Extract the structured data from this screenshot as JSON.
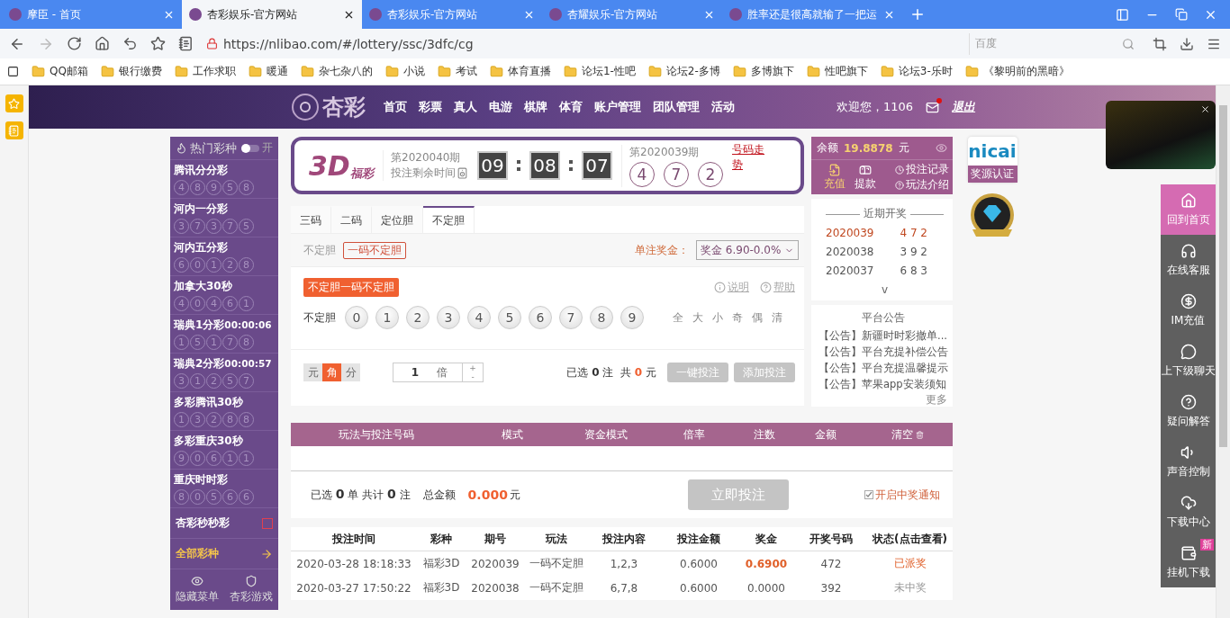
{
  "browser": {
    "tabs": [
      {
        "title": "摩臣 - 首页",
        "selected": false
      },
      {
        "title": "杏彩娱乐-官方网站",
        "selected": true
      },
      {
        "title": "杏彩娱乐-官方网站",
        "selected": false
      },
      {
        "title": "杏耀娱乐-官方网站",
        "selected": false
      },
      {
        "title": "胜率还是很高就输了一把运",
        "selected": false
      }
    ],
    "url": "https://nlibao.com/#/lottery/ssc/3dfc/cg",
    "search_placeholder": "百度",
    "bookmarks": [
      "QQ邮箱",
      "银行缴费",
      "工作求职",
      "暖通",
      "杂七杂八的",
      "小说",
      "考试",
      "体育直播",
      "论坛1-性吧",
      "论坛2-多博",
      "多博旗下",
      "性吧旗下",
      "论坛3-乐时",
      "《黎明前的黑暗》"
    ]
  },
  "header": {
    "logo": "杏彩",
    "nav": [
      "首页",
      "彩票",
      "真人",
      "电游",
      "棋牌",
      "体育",
      "账户管理",
      "团队管理",
      "活动"
    ],
    "welcome": "欢迎您，1106",
    "unread_mail": true,
    "logout": "退出"
  },
  "sidebar": {
    "title": "热门彩种",
    "toggle_label": "开",
    "toggle_on": false,
    "games": [
      {
        "name": "腾讯分分彩",
        "numbers": [
          "4",
          "8",
          "9",
          "5",
          "8"
        ]
      },
      {
        "name": "河内一分彩",
        "numbers": [
          "3",
          "7",
          "3",
          "7",
          "5"
        ]
      },
      {
        "name": "河内五分彩",
        "numbers": [
          "6",
          "0",
          "1",
          "2",
          "8"
        ]
      },
      {
        "name": "加拿大30秒",
        "numbers": [
          "4",
          "0",
          "4",
          "6",
          "1"
        ]
      },
      {
        "name": "瑞典1分彩",
        "timer": "00:00:06",
        "numbers": [
          "1",
          "5",
          "1",
          "7",
          "8"
        ]
      },
      {
        "name": "瑞典2分彩",
        "timer": "00:00:57",
        "numbers": [
          "3",
          "1",
          "2",
          "5",
          "7"
        ]
      },
      {
        "name": "多彩腾讯30秒",
        "numbers": [
          "1",
          "3",
          "2",
          "8",
          "8"
        ]
      },
      {
        "name": "多彩重庆30秒",
        "numbers": [
          "9",
          "0",
          "6",
          "1",
          "1"
        ]
      },
      {
        "name": "重庆时时彩",
        "numbers": [
          "8",
          "0",
          "5",
          "6",
          "6"
        ]
      }
    ],
    "special": "杏彩秒秒彩",
    "all_games": "全部彩种",
    "footer": [
      "隐藏菜单",
      "杏彩游戏"
    ]
  },
  "draw": {
    "logo_main": "3D",
    "logo_sub": "福彩",
    "issue": "第2020040期",
    "remaining_label": "投注剩余时间",
    "countdown": [
      "09",
      "08",
      "07"
    ],
    "last_issue": "第2020039期",
    "last_numbers": [
      "4",
      "7",
      "2"
    ],
    "trend_link": "号码走势"
  },
  "balance": {
    "label": "余额",
    "amount": "19.8878",
    "unit": "元",
    "actions": [
      {
        "label": "充值",
        "selected": true
      },
      {
        "label": "提款",
        "selected": false
      }
    ],
    "links": [
      "投注记录",
      "玩法介绍"
    ]
  },
  "play": {
    "tabs": [
      {
        "label": "三码",
        "selected": false
      },
      {
        "label": "二码",
        "selected": false
      },
      {
        "label": "定位胆",
        "selected": false
      },
      {
        "label": "不定胆",
        "selected": true
      }
    ],
    "group_label": "不定胆",
    "subtabs": [
      {
        "label": "一码不定胆",
        "selected": true
      }
    ],
    "prize_label": "单注奖金：",
    "prize_select": "奖金 6.90-0.0%",
    "tag": "不定胆一码不定胆",
    "help_links": [
      "说明",
      "帮助"
    ],
    "row_label": "不定胆",
    "digits": [
      {
        "label": "0",
        "selected": false
      },
      {
        "label": "1",
        "selected": false
      },
      {
        "label": "2",
        "selected": false
      },
      {
        "label": "3",
        "selected": false
      },
      {
        "label": "4",
        "selected": false
      },
      {
        "label": "5",
        "selected": false
      },
      {
        "label": "6",
        "selected": false
      },
      {
        "label": "7",
        "selected": false
      },
      {
        "label": "8",
        "selected": false
      },
      {
        "label": "9",
        "selected": false
      }
    ],
    "quick": [
      "全",
      "大",
      "小",
      "奇",
      "偶",
      "清"
    ],
    "units": [
      {
        "label": "元",
        "selected": false
      },
      {
        "label": "角",
        "selected": true
      },
      {
        "label": "分",
        "selected": false
      }
    ],
    "multiplier": "1",
    "multiplier_unit": "倍",
    "plus": "+",
    "minus": "-",
    "summary": "已选 **0** 注  共 **0** 元",
    "buttons": [
      {
        "label": "一键投注",
        "disabled": true
      },
      {
        "label": "添加投注",
        "disabled": true
      }
    ]
  },
  "cart": {
    "columns": [
      "玩法与投注号码",
      "模式",
      "资金模式",
      "倍率",
      "注数",
      "金额",
      "清空"
    ],
    "summary": "已选 **0** 单 共计 **0** 注",
    "total_label": "总金额",
    "total": "0.000",
    "total_unit": "元",
    "submit": {
      "label": "立即投注",
      "disabled": true
    },
    "notify": {
      "label": "开启中奖通知",
      "checked": true
    }
  },
  "history": {
    "columns": [
      "投注时间",
      "彩种",
      "期号",
      "玩法",
      "投注内容",
      "投注金额",
      "奖金",
      "开奖号码",
      "状态(点击查看)"
    ],
    "rows": [
      {
        "cells": [
          "2020-03-28 18:18:33",
          "福彩3D",
          "2020039",
          "一码不定胆",
          "1,2,3",
          "0.6000",
          "0.6900",
          "472",
          "已派奖"
        ],
        "won": true
      },
      {
        "cells": [
          "2020-03-27 17:50:22",
          "福彩3D",
          "2020038",
          "一码不定胆",
          "6,7,8",
          "0.6000",
          "0.0000",
          "392",
          "未中奖"
        ],
        "won": false
      }
    ]
  },
  "recent": {
    "title": "近期开奖",
    "rows": [
      {
        "issue": "2020039",
        "numbers": "4 7 2",
        "latest": true
      },
      {
        "issue": "2020038",
        "numbers": "3 9 2",
        "latest": false
      },
      {
        "issue": "2020037",
        "numbers": "6 8 3",
        "latest": false
      }
    ],
    "more": "v"
  },
  "notices": {
    "title": "平台公告",
    "items": [
      "【公告】新疆时时彩撤单...",
      "【公告】平台充提补偿公告",
      "【公告】平台充提温馨提示",
      "【公告】苹果app安装须知"
    ],
    "more": "更多"
  },
  "badges": {
    "logo": "nicai",
    "label": "奖源认证"
  },
  "dock": [
    {
      "label": "回到首页",
      "selected": true,
      "kind": "home"
    },
    {
      "label": "在线客服",
      "selected": false,
      "kind": "service"
    },
    {
      "label": "IM充值",
      "selected": false,
      "kind": "im"
    },
    {
      "label": "上下级聊天",
      "selected": false,
      "kind": "chat"
    },
    {
      "label": "疑问解答",
      "selected": false,
      "kind": "help"
    },
    {
      "label": "声音控制",
      "selected": false,
      "kind": "sound"
    },
    {
      "label": "下载中心",
      "selected": false,
      "kind": "download"
    },
    {
      "label": "挂机下载",
      "selected": false,
      "kind": "bot",
      "badge": "新"
    }
  ]
}
